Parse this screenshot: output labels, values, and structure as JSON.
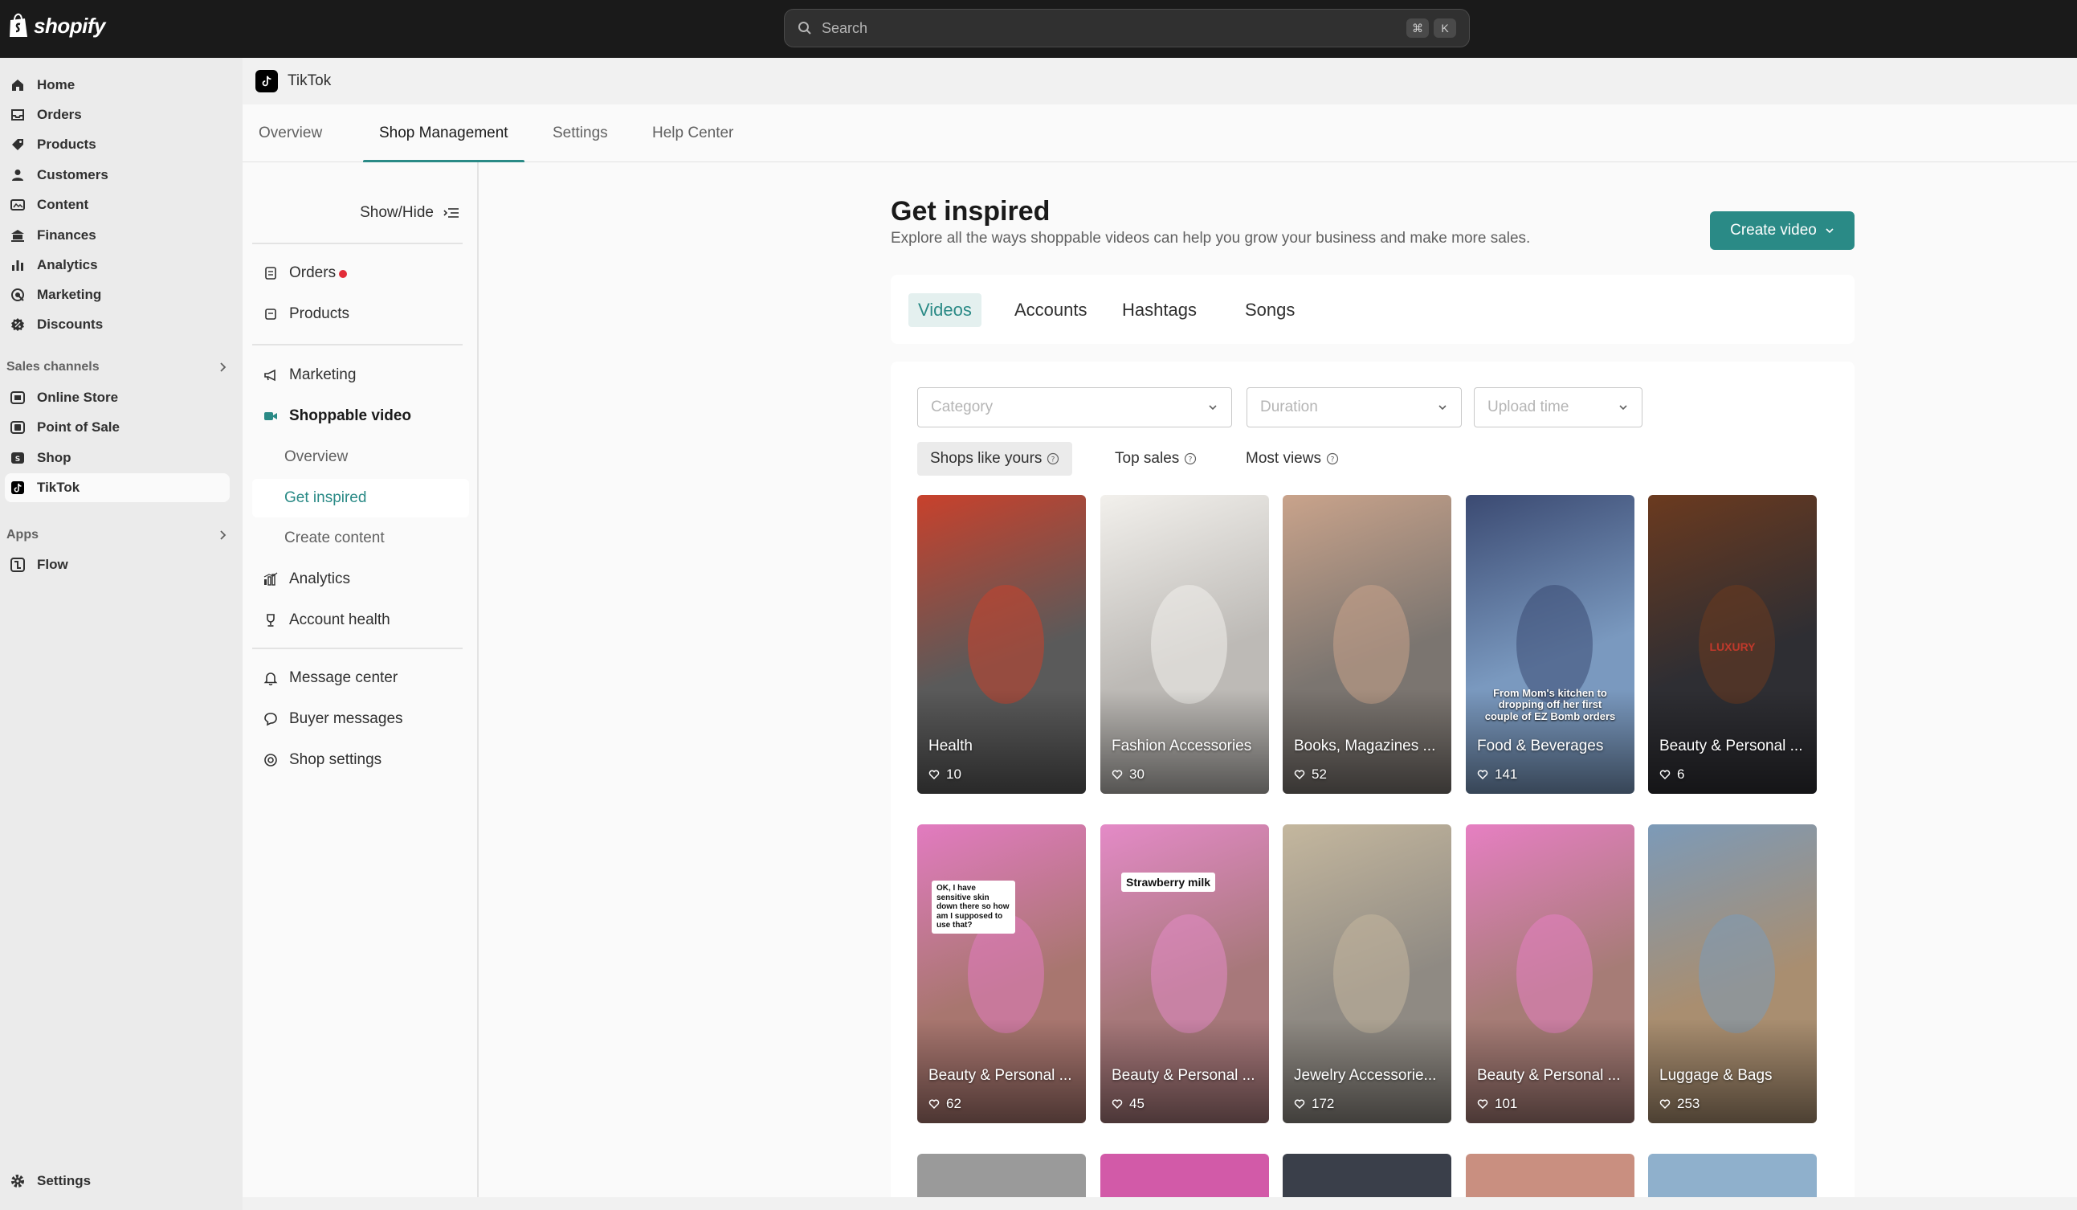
{
  "topbar": {
    "logo_text": "shopify",
    "search_placeholder": "Search",
    "shortcut_keys": [
      "⌘",
      "K"
    ]
  },
  "leftnav": {
    "items": [
      {
        "label": "Home",
        "icon": "home-icon"
      },
      {
        "label": "Orders",
        "icon": "inbox-icon"
      },
      {
        "label": "Products",
        "icon": "tag-icon"
      },
      {
        "label": "Customers",
        "icon": "person-icon"
      },
      {
        "label": "Content",
        "icon": "image-icon"
      },
      {
        "label": "Finances",
        "icon": "bank-icon"
      },
      {
        "label": "Analytics",
        "icon": "bar-chart-icon"
      },
      {
        "label": "Marketing",
        "icon": "target-icon"
      },
      {
        "label": "Discounts",
        "icon": "discount-icon"
      }
    ],
    "sales_channels_label": "Sales channels",
    "channels": [
      {
        "label": "Online Store",
        "icon": "store-icon"
      },
      {
        "label": "Point of Sale",
        "icon": "pos-icon"
      },
      {
        "label": "Shop",
        "icon": "shop-icon"
      },
      {
        "label": "TikTok",
        "icon": "tiktok-icon"
      }
    ],
    "apps_label": "Apps",
    "apps": [
      {
        "label": "Flow",
        "icon": "flow-icon"
      }
    ],
    "settings_label": "Settings"
  },
  "app": {
    "title": "TikTok",
    "tabs": [
      "Overview",
      "Shop Management",
      "Settings",
      "Help Center"
    ]
  },
  "subnav": {
    "show_hide_label": "Show/Hide",
    "orders": "Orders",
    "products": "Products",
    "marketing": "Marketing",
    "shoppable_video": "Shoppable video",
    "overview": "Overview",
    "get_inspired": "Get inspired",
    "create_content": "Create content",
    "analytics": "Analytics",
    "account_health": "Account health",
    "message_center": "Message center",
    "buyer_messages": "Buyer messages",
    "shop_settings": "Shop settings"
  },
  "main": {
    "title": "Get inspired",
    "subtitle": "Explore all the ways shoppable videos can help you grow your business and make more sales.",
    "create_video_label": "Create video",
    "content_tabs": [
      "Videos",
      "Accounts",
      "Hashtags",
      "Songs"
    ],
    "filters": {
      "category": "Category",
      "duration": "Duration",
      "upload_time": "Upload time"
    },
    "sort_options": [
      "Shops like yours",
      "Top sales",
      "Most views"
    ],
    "videos": [
      {
        "category": "Health",
        "likes": "10",
        "bg": "#5a5a5a",
        "accent": "#c8412c"
      },
      {
        "category": "Fashion Accessories",
        "likes": "30",
        "bg": "#bdbab6",
        "accent": "#f2f0ec"
      },
      {
        "category": "Books, Magazines ...",
        "likes": "52",
        "bg": "#7b7570",
        "accent": "#c9a38b"
      },
      {
        "category": "Food & Beverages",
        "likes": "141",
        "bg": "#7a99bf",
        "accent": "#3b4a72"
      },
      {
        "category": "Beauty & Personal ...",
        "likes": "6",
        "bg": "#2e2e33",
        "accent": "#6b3a1f"
      },
      {
        "category": "Beauty & Personal ...",
        "likes": "62",
        "bg": "#a8766f",
        "accent": "#e27bc0"
      },
      {
        "category": "Beauty & Personal ...",
        "likes": "45",
        "bg": "#a7787a",
        "accent": "#e48ac7"
      },
      {
        "category": "Jewelry Accessorie...",
        "likes": "172",
        "bg": "#8f8a83",
        "accent": "#c4b79e"
      },
      {
        "category": "Beauty & Personal ...",
        "likes": "101",
        "bg": "#a67c76",
        "accent": "#e67fc2"
      },
      {
        "category": "Luggage & Bags",
        "likes": "253",
        "bg": "#a98e70",
        "accent": "#7c9ab8"
      }
    ],
    "caption_box": "OK, I have sensitive skin down there so how am I supposed to use that?",
    "caption_strawberry": "Strawberry milk",
    "overlay_food": "From Mom's kitchen to dropping off her first couple of EZ Bomb orders",
    "overlay_luxury": "LUXURY"
  },
  "colors": {
    "accent": "#2a8a86",
    "topbar": "#1a1a1a",
    "alert": "#e22c38"
  }
}
